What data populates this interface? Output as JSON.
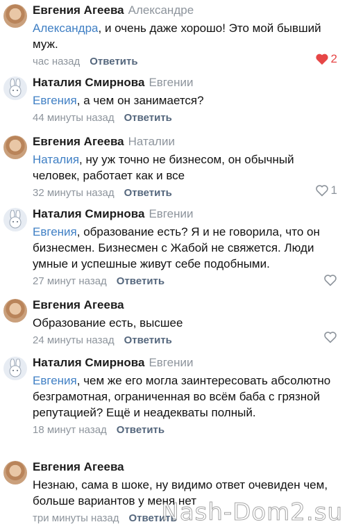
{
  "colors": {
    "mention": "#3f7fc4",
    "meta": "#8d949c",
    "reply_action": "#55677d",
    "liked": "#e64646"
  },
  "comments": [
    {
      "author": "Евгения Агеева",
      "reply_to": "Александре",
      "avatar": "photo",
      "mention": "Александра",
      "text": ", и очень даже хорошо! Это мой бывший муж.",
      "time": "час назад",
      "reply_label": "Ответить",
      "likes": "2",
      "liked": true
    },
    {
      "author": "Наталия Смирнова",
      "reply_to": "Евгении",
      "avatar": "bunny-icon",
      "mention": "Евгения",
      "text": ", а чем он занимается?",
      "time": "44 минуты назад",
      "reply_label": "Ответить",
      "likes": "",
      "liked": false
    },
    {
      "author": "Евгения Агеева",
      "reply_to": "Наталии",
      "avatar": "photo",
      "mention": "Наталия",
      "text": ", ну уж точно не бизнесом, он обычный человек, работает как и все",
      "time": "32 минуты назад",
      "reply_label": "Ответить",
      "likes": "1",
      "liked": false
    },
    {
      "author": "Наталия Смирнова",
      "reply_to": "Евгении",
      "avatar": "bunny-icon",
      "mention": "Евгения",
      "text": ", образование есть? Я и не говорила, что он бизнесмен. Бизнесмен с Жабой не свяжется. Люди умные и успешные живут себе подобными.",
      "time": "27 минут назад",
      "reply_label": "Ответить",
      "likes": "",
      "liked": false
    },
    {
      "author": "Евгения Агеева",
      "reply_to": "",
      "avatar": "photo",
      "mention": "",
      "text": "Образование есть, высшее",
      "time": "24 минуты назад",
      "reply_label": "Ответить",
      "likes": "",
      "liked": false
    },
    {
      "author": "Наталия Смирнова",
      "reply_to": "Евгении",
      "avatar": "bunny-icon",
      "mention": "Евгения",
      "text": ", чем же его могла заинтересовать абсолютно безграмотная, ограниченная во всём баба с грязной репутацией? Ещё и неадекваты полный.",
      "time": "18 минут назад",
      "reply_label": "Ответить",
      "likes": "",
      "liked": false
    },
    {
      "author": "Евгения Агеева",
      "reply_to": "",
      "avatar": "photo",
      "mention": "",
      "text": "Незнаю, сама в шоке, ну видимо ответ очевиден чем, больше вариантов у меня нет",
      "time": "три минуты назад",
      "reply_label": "Ответить",
      "likes": "",
      "liked": false
    }
  ],
  "watermark": "Nash-Dom2.su"
}
